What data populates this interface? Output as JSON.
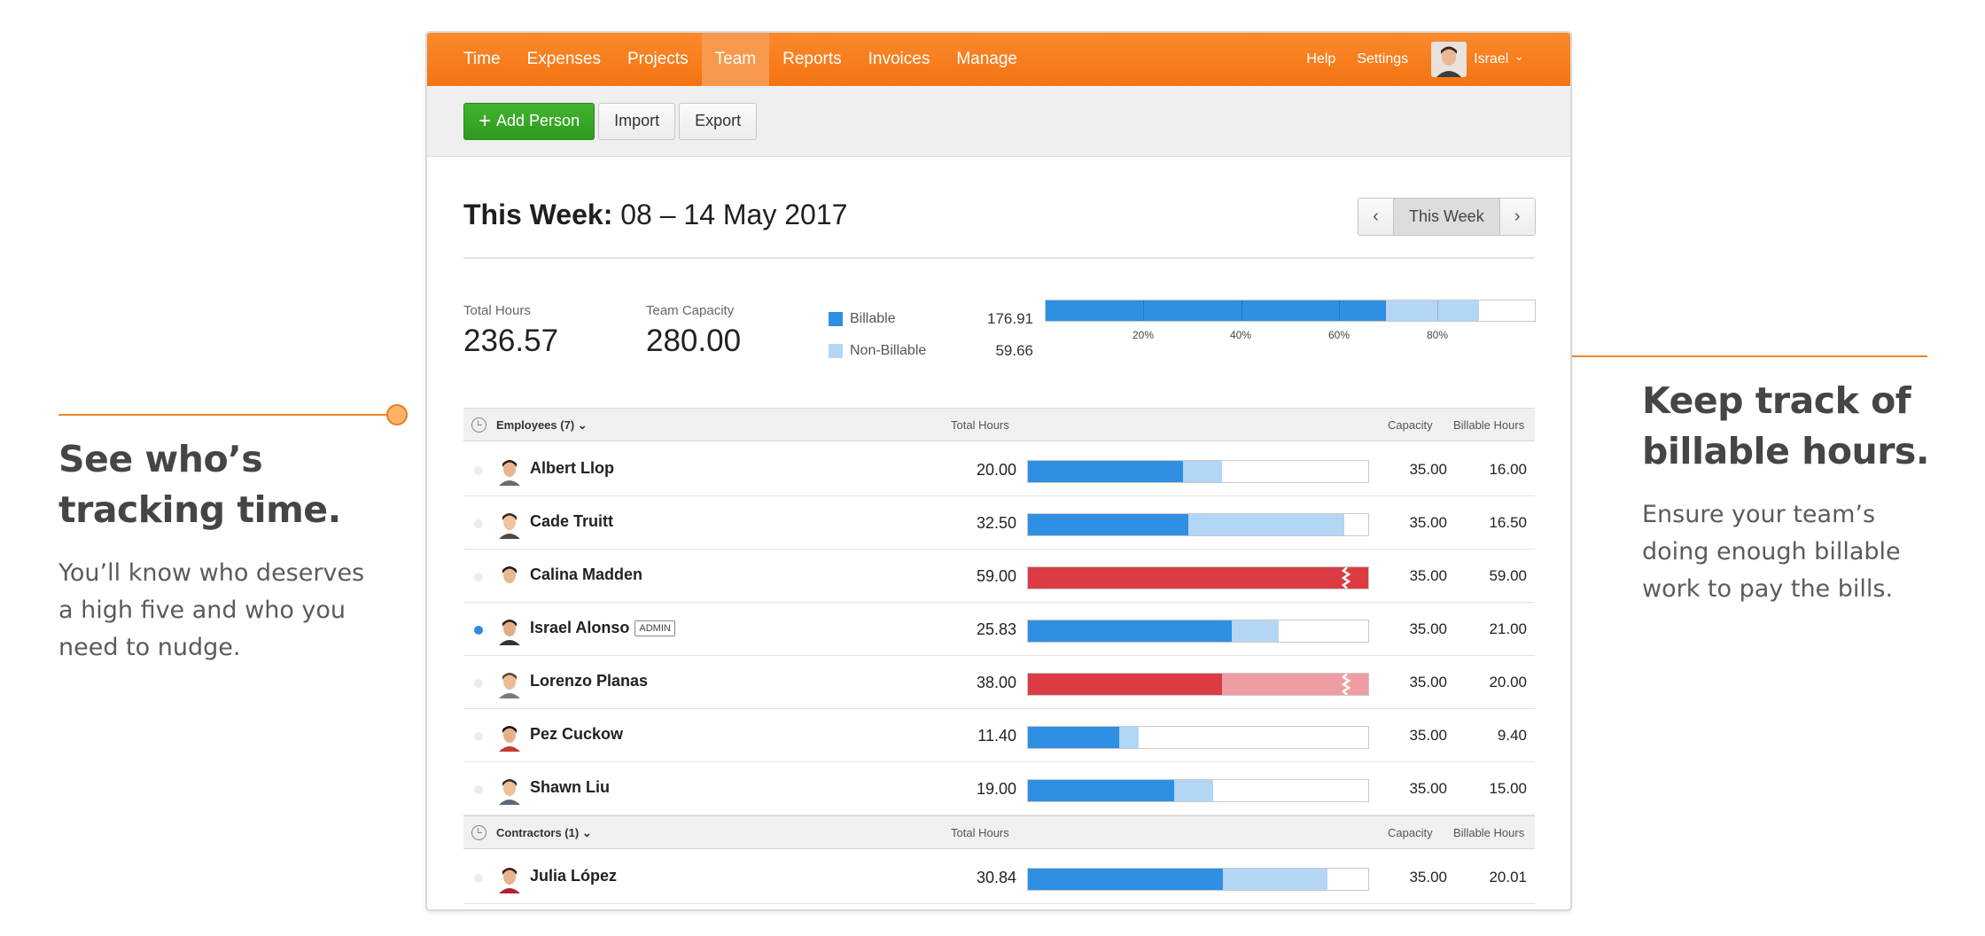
{
  "callouts": {
    "left": {
      "title": "See who’s tracking time.",
      "body": "You’ll know who deserves a high five and who you need to nudge."
    },
    "right": {
      "title": "Keep track of billable hours.",
      "body": "Ensure your team’s doing enough billable work to pay the bills."
    }
  },
  "nav": {
    "items": [
      "Time",
      "Expenses",
      "Projects",
      "Team",
      "Reports",
      "Invoices",
      "Manage"
    ],
    "active": "Team",
    "help": "Help",
    "settings": "Settings",
    "user": "Israel",
    "user_chevron": "⌄"
  },
  "toolbar": {
    "add_person": "Add Person",
    "import": "Import",
    "export": "Export"
  },
  "week": {
    "title_bold": "This Week:",
    "range": "08 – 14 May 2017",
    "prev": "‹",
    "current": "This Week",
    "next": "›"
  },
  "summary": {
    "total_hours_label": "Total Hours",
    "total_hours": "236.57",
    "capacity_label": "Team Capacity",
    "capacity": "280.00",
    "billable_label": "Billable",
    "billable_value": "176.91",
    "nonbillable_label": "Non-Billable",
    "nonbillable_value": "59.66",
    "billable_fraction": 0.696,
    "nonbillable_fraction": 0.19,
    "tick_labels": [
      "20%",
      "40%",
      "60%",
      "80%"
    ]
  },
  "colors": {
    "orange": "#f47312",
    "billable": "#2f8fe2",
    "nonbillable": "#b3d6f5",
    "over": "#dc3b44",
    "over_light": "#ee9ea3"
  },
  "columns": {
    "total_hours": "Total Hours",
    "capacity": "Capacity",
    "billable_hours": "Billable Hours"
  },
  "employees": {
    "title": "Employees (7)",
    "rows": [
      {
        "name": "Albert Llop",
        "hours": "20.00",
        "capacity": "35.00",
        "billable": "16.00",
        "active": false,
        "admin": false,
        "b": 0.457,
        "nb": 0.571,
        "over": false
      },
      {
        "name": "Cade Truitt",
        "hours": "32.50",
        "capacity": "35.00",
        "billable": "16.50",
        "active": false,
        "admin": false,
        "b": 0.471,
        "nb": 0.929,
        "over": false
      },
      {
        "name": "Calina Madden",
        "hours": "59.00",
        "capacity": "35.00",
        "billable": "59.00",
        "active": false,
        "admin": false,
        "b": 1.0,
        "nb": 1.0,
        "over": true
      },
      {
        "name": "Israel Alonso",
        "hours": "25.83",
        "capacity": "35.00",
        "billable": "21.00",
        "active": true,
        "admin": true,
        "badge": "ADMIN",
        "b": 0.6,
        "nb": 0.738,
        "over": false
      },
      {
        "name": "Lorenzo Planas",
        "hours": "38.00",
        "capacity": "35.00",
        "billable": "20.00",
        "active": false,
        "admin": false,
        "b": 0.571,
        "nb": 1.0,
        "over": true
      },
      {
        "name": "Pez Cuckow",
        "hours": "11.40",
        "capacity": "35.00",
        "billable": "9.40",
        "active": false,
        "admin": false,
        "b": 0.269,
        "nb": 0.326,
        "over": false
      },
      {
        "name": "Shawn Liu",
        "hours": "19.00",
        "capacity": "35.00",
        "billable": "15.00",
        "active": false,
        "admin": false,
        "b": 0.429,
        "nb": 0.543,
        "over": false
      }
    ]
  },
  "contractors": {
    "title": "Contractors (1)",
    "rows": [
      {
        "name": "Julia López",
        "hours": "30.84",
        "capacity": "35.00",
        "billable": "20.01",
        "active": false,
        "admin": false,
        "b": 0.572,
        "nb": 0.881,
        "over": false
      }
    ]
  }
}
